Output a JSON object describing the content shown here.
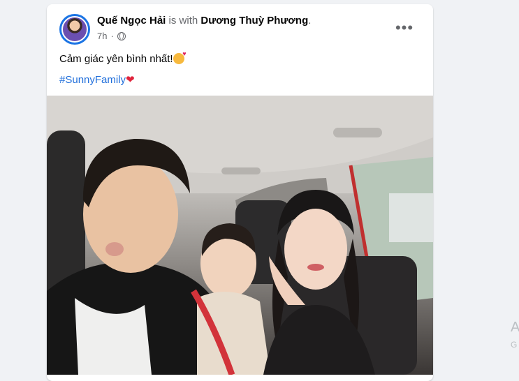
{
  "post": {
    "author": "Quế Ngọc Hải",
    "with_text": " is with ",
    "tagged": "Dương Thuỳ Phương",
    "period": ".",
    "time": "7h",
    "privacy_icon": "globe-icon",
    "more_icon": "more-options-icon",
    "more_glyph": "•••",
    "text": "Cảm giác yên bình nhất!",
    "text_emoji": "smiling-face-with-hearts-emoji",
    "hashtag": "#SunnyFamily",
    "hashtag_emoji": "red-heart-emoji"
  },
  "sidebar": {
    "letter_a": "A",
    "letter_g": "G"
  },
  "colors": {
    "link": "#216fdb",
    "avatar_ring": "#1b74e4",
    "meta": "#65676b"
  }
}
